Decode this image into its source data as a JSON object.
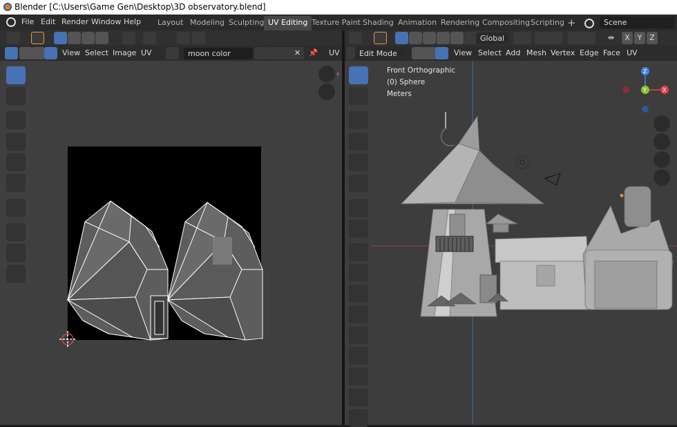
{
  "window": {
    "title": "Blender [C:\\Users\\Game Gen\\Desktop\\3D observatory.blend]"
  },
  "menu": [
    "File",
    "Edit",
    "Render",
    "Window",
    "Help"
  ],
  "workspaces": [
    "Layout",
    "Modeling",
    "Sculpting",
    "UV Editing",
    "Texture Paint",
    "Shading",
    "Animation",
    "Rendering",
    "Compositing",
    "Scripting"
  ],
  "active_workspace": "UV Editing",
  "scene_name": "Scene",
  "uv_editor": {
    "menus": [
      "View",
      "Select",
      "Image",
      "UV"
    ],
    "image_name": "moon color",
    "trailing_label": "UV"
  },
  "viewport": {
    "mode": "Edit Mode",
    "menus": [
      "View",
      "Select",
      "Add",
      "Mesh",
      "Vertex",
      "Edge",
      "Face",
      "UV"
    ],
    "orientation": "Global",
    "axes": [
      "X",
      "Y",
      "Z"
    ],
    "overlay_lines": [
      "Front Orthographic",
      "(0) Sphere",
      "Meters"
    ],
    "gizmo": {
      "x_label": "X",
      "y_label": "Y",
      "z_label": "Z",
      "x_color": "#e5414b",
      "y_color": "#88c534",
      "z_color": "#3f86e0"
    }
  },
  "colors": {
    "accent": "#4772b3",
    "x_axis_line": "#9a3c47",
    "y_axis_line": "#3d6ea3"
  }
}
